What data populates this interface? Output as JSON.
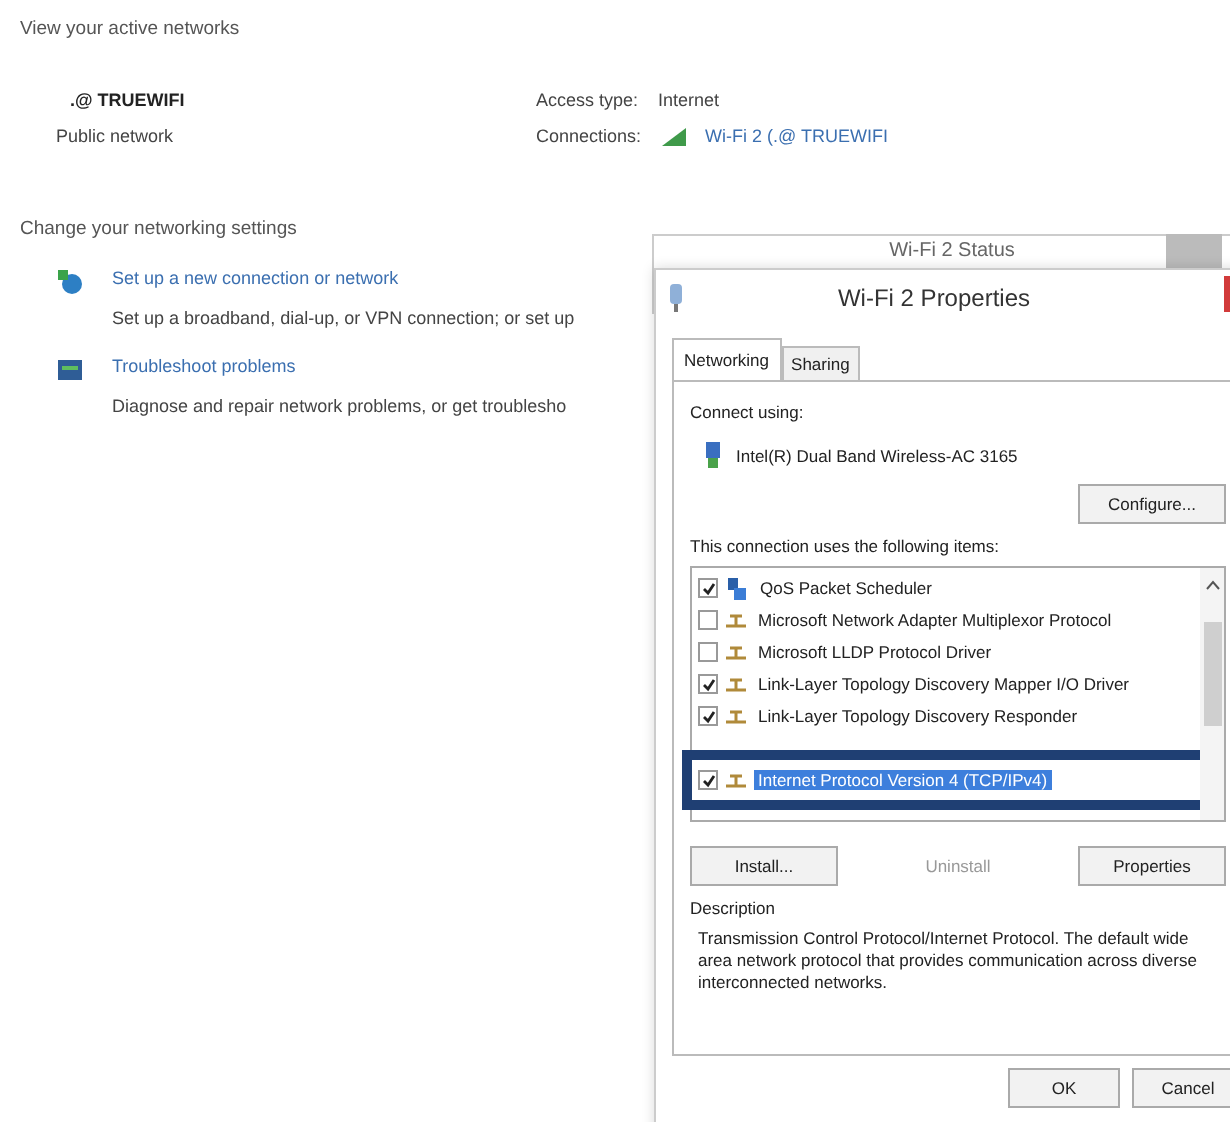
{
  "page": {
    "active_heading": "View your active networks",
    "network": {
      "name": ".@ TRUEWIFI",
      "category": "Public network",
      "access_label": "Access type:",
      "access_value": "Internet",
      "connections_label": "Connections:",
      "connection_link": "Wi-Fi 2 (.@ TRUEWIFI"
    },
    "settings_heading": "Change your networking settings",
    "tasks": [
      {
        "kind": "connection",
        "title": "Set up a new connection or network",
        "description": "Set up a broadband, dial-up, or VPN connection; or set up"
      },
      {
        "kind": "troubleshoot",
        "title": "Troubleshoot problems",
        "description": "Diagnose and repair network problems, or get troublesho"
      }
    ]
  },
  "status_window": {
    "title": "Wi-Fi 2 Status"
  },
  "dialog": {
    "title": "Wi-Fi 2 Properties",
    "tabs": [
      {
        "label": "Networking",
        "selected": true
      },
      {
        "label": "Sharing",
        "selected": false
      }
    ],
    "connect_label": "Connect using:",
    "adapter": "Intel(R) Dual Band Wireless-AC 3165",
    "configure_button": "Configure...",
    "items_label": "This connection uses the following items:",
    "items": [
      {
        "kind": "scheduler",
        "label": "QoS Packet Scheduler",
        "checked": true,
        "selected": false,
        "highlighted": false
      },
      {
        "kind": "protocol",
        "label": "Microsoft Network Adapter Multiplexor Protocol",
        "checked": false,
        "selected": false,
        "highlighted": false
      },
      {
        "kind": "protocol",
        "label": "Microsoft LLDP Protocol Driver",
        "checked": false,
        "selected": false,
        "highlighted": false
      },
      {
        "kind": "protocol",
        "label": "Link-Layer Topology Discovery Mapper I/O Driver",
        "checked": true,
        "selected": false,
        "highlighted": false
      },
      {
        "kind": "protocol",
        "label": "Link-Layer Topology Discovery Responder",
        "checked": true,
        "selected": false,
        "highlighted": false
      },
      {
        "kind": "protocol",
        "label": "Internet Protocol Version 4 (TCP/IPv4)",
        "checked": true,
        "selected": true,
        "highlighted": true
      }
    ],
    "buttons": [
      {
        "label": "Install...",
        "disabled": false
      },
      {
        "label": "Uninstall",
        "disabled": true
      },
      {
        "label": "Properties",
        "disabled": false
      }
    ],
    "description_label": "Description",
    "description": "Transmission Control Protocol/Internet Protocol. The default wide area network protocol that provides communication across diverse interconnected networks.",
    "footer_buttons": [
      "OK",
      "Cancel"
    ]
  }
}
